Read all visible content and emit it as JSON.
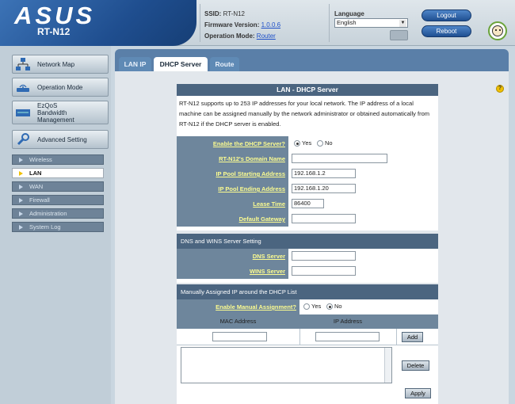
{
  "header": {
    "logo": "ASUS",
    "model": "RT-N12",
    "ssid_label": "SSID:",
    "ssid_value": "RT-N12",
    "firmware_label": "Firmware Version:",
    "firmware_value": "1.0.0.6",
    "opmode_label": "Operation Mode:",
    "opmode_value": "Router",
    "language_label": "Language",
    "language_value": "English",
    "logout_label": "Logout",
    "reboot_label": "Reboot"
  },
  "sidebar": {
    "main_items": [
      {
        "label": "Network Map",
        "icon": "network-map-icon"
      },
      {
        "label": "Operation Mode",
        "icon": "router-icon"
      },
      {
        "label_lines": [
          "EzQoS",
          "Bandwidth",
          "Management"
        ],
        "icon": "bandwidth-icon"
      },
      {
        "label": "Advanced Setting",
        "icon": "wrench-icon"
      }
    ],
    "sub_items": [
      "Wireless",
      "LAN",
      "WAN",
      "Firewall",
      "Administration",
      "System Log"
    ],
    "active_sub_item": "LAN"
  },
  "tabs": [
    "LAN IP",
    "DHCP Server",
    "Route"
  ],
  "active_tab": "DHCP Server",
  "form": {
    "title": "LAN - DHCP Server",
    "description": "RT-N12 supports up to 253 IP addresses for your local network. The IP address of a local machine can be assigned manually by the network administrator or obtained automatically from RT-N12 if the DHCP server is enabled.",
    "fields": {
      "enable_dhcp": {
        "label": "Enable the DHCP Server?",
        "yes": "Yes",
        "no": "No",
        "selected": "Yes"
      },
      "domain_name": {
        "label": "RT-N12's Domain Name",
        "value": ""
      },
      "pool_start": {
        "label": "IP Pool Starting Address",
        "value": "192.168.1.2"
      },
      "pool_end": {
        "label": "IP Pool Ending Address",
        "value": "192.168.1.20"
      },
      "lease_time": {
        "label": "Lease Time",
        "value": "86400"
      },
      "default_gateway": {
        "label": "Default Gateway",
        "value": ""
      }
    },
    "dns_section": {
      "title": "DNS and WINS Server Setting",
      "dns_label": "DNS Server",
      "dns_value": "",
      "wins_label": "WINS Server",
      "wins_value": ""
    },
    "manual_section": {
      "title": "Manually Assigned IP around the DHCP List",
      "enable_label": "Enable Manual Assignment?",
      "yes": "Yes",
      "no": "No",
      "selected": "No",
      "mac_header": "MAC Address",
      "ip_header": "IP Address",
      "add_label": "Add",
      "delete_label": "Delete",
      "apply_label": "Apply"
    }
  },
  "colors": {
    "header_blue": "#1f4e8f",
    "label_bg": "#6e869c",
    "label_text": "#fcfc90",
    "section_bg": "#4b6580",
    "tab_bar": "#5a7fa8"
  }
}
